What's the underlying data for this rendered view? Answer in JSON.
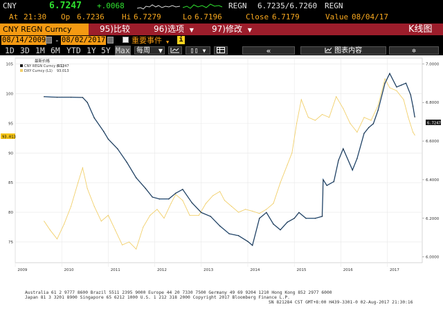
{
  "quote": {
    "ticker": "CNY",
    "price": "6.7247",
    "change": "+.0068",
    "source": "REGN",
    "bid_ask": "6.7235/6.7260",
    "source2": "REGN",
    "at_label": "At",
    "at_value": "21:30",
    "op_label": "Op",
    "op_value": "6.7236",
    "hi_label": "Hi",
    "hi_value": "6.7279",
    "lo_label": "Lo",
    "lo_value": "6.7196",
    "close_label": "Close",
    "close_value": "6.7179",
    "value_label": "Value",
    "value_date": "08/04/17"
  },
  "function_bar": {
    "security": "CNY REGN Curncy",
    "menus": [
      {
        "num": "95)",
        "label": "比较"
      },
      {
        "num": "96)",
        "label": "选项"
      },
      {
        "num": "97)",
        "label": "修改"
      }
    ],
    "title": "K线图"
  },
  "date_bar": {
    "start": "08/14/2009",
    "dash": "-",
    "end": "08/02/2017",
    "events_label": "重要事件",
    "info": "i"
  },
  "range_bar": {
    "ranges": [
      "1D",
      "3D",
      "1M",
      "6M",
      "YTD",
      "1Y",
      "5Y",
      "Max"
    ],
    "selected": "Max",
    "period": "每周",
    "series_label": "图表内容"
  },
  "chart_data": {
    "type": "line",
    "legend_title": "最新价格",
    "legend": [
      {
        "name": "CNY REGN Curncy (R1)",
        "value": "6.7247",
        "color": "#1a1a1a"
      },
      {
        "name": "DXY Curncy (L1)",
        "value": "93.013",
        "color": "#f2d06b"
      }
    ],
    "x_ticks": [
      "2009",
      "2010",
      "2011",
      "2012",
      "2013",
      "2014",
      "2015",
      "2016",
      "2017"
    ],
    "left_axis": {
      "ticks": [
        "105",
        "100",
        "95",
        "90",
        "85",
        "80",
        "75"
      ],
      "range": [
        71.5,
        106
      ]
    },
    "right_axis": {
      "ticks": [
        "7.0000",
        "6.8000",
        "6.6000",
        "6.4000",
        "6.2000",
        "6.0000"
      ],
      "range": [
        5.97,
        7.03
      ]
    },
    "last_left_label": "93.013",
    "last_right_label": "6.7247",
    "cny_series": [
      [
        2009.62,
        6.83
      ],
      [
        2009.9,
        6.827
      ],
      [
        2010.2,
        6.827
      ],
      [
        2010.45,
        6.826
      ],
      [
        2010.55,
        6.8
      ],
      [
        2010.7,
        6.72
      ],
      [
        2010.9,
        6.65
      ],
      [
        2011.0,
        6.61
      ],
      [
        2011.2,
        6.56
      ],
      [
        2011.4,
        6.49
      ],
      [
        2011.6,
        6.41
      ],
      [
        2011.8,
        6.355
      ],
      [
        2011.95,
        6.31
      ],
      [
        2012.1,
        6.3
      ],
      [
        2012.3,
        6.3
      ],
      [
        2012.45,
        6.33
      ],
      [
        2012.6,
        6.35
      ],
      [
        2012.8,
        6.28
      ],
      [
        2013.0,
        6.23
      ],
      [
        2013.2,
        6.21
      ],
      [
        2013.4,
        6.16
      ],
      [
        2013.6,
        6.12
      ],
      [
        2013.8,
        6.11
      ],
      [
        2014.0,
        6.08
      ],
      [
        2014.1,
        6.06
      ],
      [
        2014.25,
        6.2
      ],
      [
        2014.4,
        6.23
      ],
      [
        2014.55,
        6.17
      ],
      [
        2014.7,
        6.14
      ],
      [
        2014.85,
        6.18
      ],
      [
        2015.0,
        6.2
      ],
      [
        2015.1,
        6.23
      ],
      [
        2015.25,
        6.2
      ],
      [
        2015.45,
        6.2
      ],
      [
        2015.6,
        6.21
      ],
      [
        2015.62,
        6.4
      ],
      [
        2015.7,
        6.37
      ],
      [
        2015.85,
        6.39
      ],
      [
        2015.95,
        6.5
      ],
      [
        2016.05,
        6.56
      ],
      [
        2016.25,
        6.45
      ],
      [
        2016.35,
        6.51
      ],
      [
        2016.5,
        6.64
      ],
      [
        2016.6,
        6.67
      ],
      [
        2016.7,
        6.69
      ],
      [
        2016.8,
        6.76
      ],
      [
        2016.95,
        6.9
      ],
      [
        2017.05,
        6.95
      ],
      [
        2017.2,
        6.88
      ],
      [
        2017.3,
        6.89
      ],
      [
        2017.4,
        6.9
      ],
      [
        2017.5,
        6.84
      ],
      [
        2017.55,
        6.78
      ],
      [
        2017.59,
        6.7247
      ]
    ],
    "dxy_series": [
      [
        2009.62,
        78.5
      ],
      [
        2009.75,
        77.0
      ],
      [
        2009.9,
        75.5
      ],
      [
        2010.05,
        78.0
      ],
      [
        2010.2,
        81.0
      ],
      [
        2010.35,
        85.0
      ],
      [
        2010.45,
        87.5
      ],
      [
        2010.55,
        84.0
      ],
      [
        2010.7,
        81.0
      ],
      [
        2010.85,
        78.5
      ],
      [
        2011.0,
        79.5
      ],
      [
        2011.15,
        77.0
      ],
      [
        2011.3,
        74.5
      ],
      [
        2011.45,
        75.0
      ],
      [
        2011.6,
        73.8
      ],
      [
        2011.75,
        77.5
      ],
      [
        2011.9,
        79.5
      ],
      [
        2012.05,
        80.5
      ],
      [
        2012.2,
        79.0
      ],
      [
        2012.35,
        81.5
      ],
      [
        2012.45,
        83.0
      ],
      [
        2012.6,
        82.0
      ],
      [
        2012.75,
        79.5
      ],
      [
        2012.95,
        79.5
      ],
      [
        2013.1,
        81.5
      ],
      [
        2013.25,
        82.8
      ],
      [
        2013.4,
        83.5
      ],
      [
        2013.5,
        82.0
      ],
      [
        2013.65,
        81.0
      ],
      [
        2013.8,
        80.0
      ],
      [
        2013.95,
        80.5
      ],
      [
        2014.1,
        80.2
      ],
      [
        2014.25,
        79.8
      ],
      [
        2014.4,
        80.5
      ],
      [
        2014.55,
        81.5
      ],
      [
        2014.7,
        85.0
      ],
      [
        2014.85,
        88.0
      ],
      [
        2014.95,
        90.0
      ],
      [
        2015.05,
        95.0
      ],
      [
        2015.15,
        99.0
      ],
      [
        2015.3,
        96.0
      ],
      [
        2015.45,
        95.5
      ],
      [
        2015.6,
        96.5
      ],
      [
        2015.75,
        96.0
      ],
      [
        2015.9,
        99.5
      ],
      [
        2016.05,
        97.5
      ],
      [
        2016.2,
        95.0
      ],
      [
        2016.35,
        93.5
      ],
      [
        2016.5,
        96.0
      ],
      [
        2016.65,
        95.5
      ],
      [
        2016.8,
        98.0
      ],
      [
        2016.95,
        102.5
      ],
      [
        2017.05,
        101.0
      ],
      [
        2017.2,
        100.5
      ],
      [
        2017.35,
        99.0
      ],
      [
        2017.45,
        96.0
      ],
      [
        2017.55,
        93.5
      ],
      [
        2017.59,
        93.013
      ]
    ]
  },
  "footer": {
    "line1": "Australia 61 2 9777 8600 Brazil 5511 2395 9000 Europe 44 20 7330 7500 Germany 49 69 9204 1210 Hong Kong 852 2977 6000",
    "line2": "Japan 81 3 3201 8900         Singapore 65 6212 1000         U.S. 1 212 318 2000         Copyright 2017 Bloomberg Finance L.P.",
    "line3": "SN 821284 CST  GMT+8:00 H439-3301-0 02-Aug-2017 21:30:16"
  }
}
